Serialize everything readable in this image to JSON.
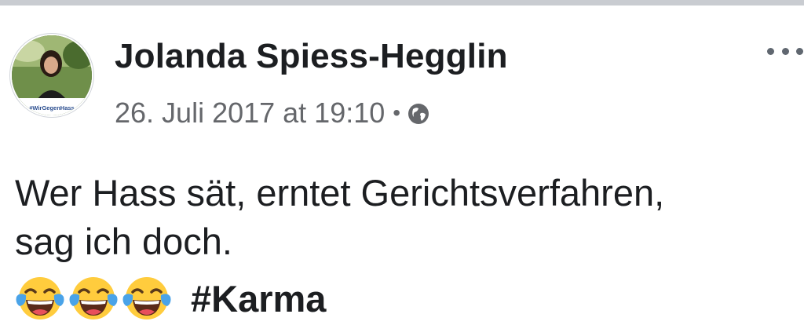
{
  "post": {
    "author_name": "Jolanda Spiess-Hegglin",
    "avatar_badge": "#WirGegenHass",
    "timestamp": "26. Juli 2017 at 19:10",
    "separator": "•",
    "privacy_icon": "globe-icon",
    "more_icon": "more-options-icon",
    "text_line1": "Wer Hass sät, erntet Gerichtsverfahren,",
    "text_line2": "sag ich doch.",
    "emoji": [
      "face-with-tears-of-joy-icon",
      "face-with-tears-of-joy-icon",
      "face-with-tears-of-joy-icon"
    ],
    "hashtag": "#Karma"
  },
  "colors": {
    "text_primary": "#1c1e21",
    "text_secondary": "#65676b",
    "top_bar": "#c9ccd1"
  }
}
